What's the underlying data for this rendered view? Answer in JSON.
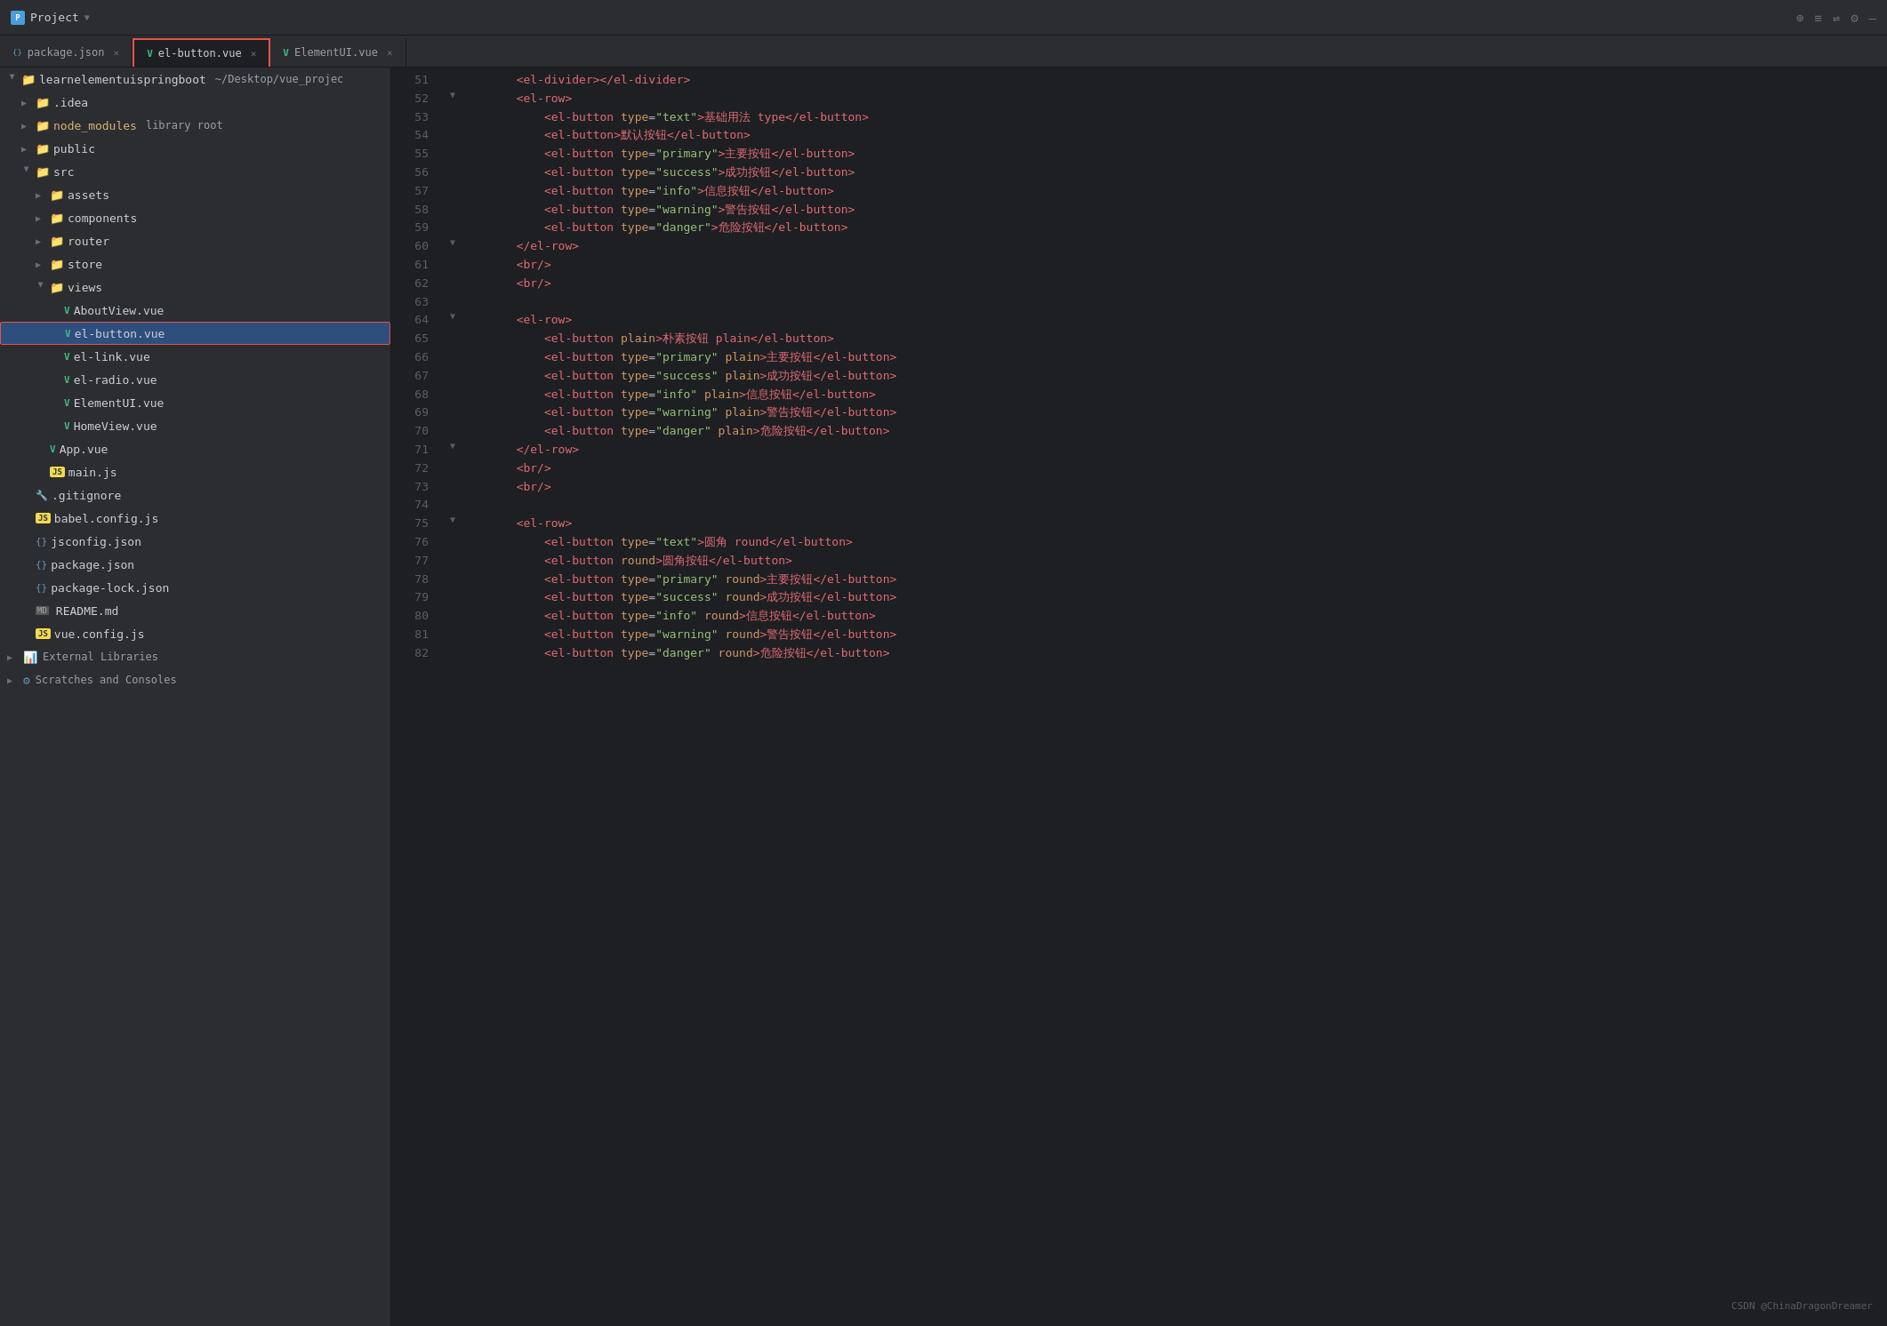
{
  "titleBar": {
    "projectLabel": "Project",
    "projectTitle": "Project",
    "dropdownArrow": "▼",
    "icons": [
      "⊕",
      "≡",
      "⇌",
      "⚙",
      "—"
    ]
  },
  "tabs": [
    {
      "id": "package-json",
      "icon": "json",
      "label": "package.json",
      "active": false,
      "highlighted": false
    },
    {
      "id": "el-button-vue",
      "icon": "vue",
      "label": "el-button.vue",
      "active": true,
      "highlighted": true
    },
    {
      "id": "elementui-vue",
      "icon": "vue",
      "label": "ElementUI.vue",
      "active": false,
      "highlighted": false
    }
  ],
  "sidebar": {
    "rootLabel": "learnelementuispringboot",
    "rootSubtitle": "~/Desktop/vue_projec",
    "items": [
      {
        "indent": 1,
        "type": "folder-blue",
        "arrow": "closed",
        "name": ".idea",
        "subtitle": ""
      },
      {
        "indent": 1,
        "type": "folder-yellow",
        "arrow": "closed",
        "name": "node_modules",
        "subtitle": "library root"
      },
      {
        "indent": 1,
        "type": "folder",
        "arrow": "closed",
        "name": "public",
        "subtitle": ""
      },
      {
        "indent": 1,
        "type": "folder",
        "arrow": "open",
        "name": "src",
        "subtitle": ""
      },
      {
        "indent": 2,
        "type": "folder",
        "arrow": "closed",
        "name": "assets",
        "subtitle": ""
      },
      {
        "indent": 2,
        "type": "folder",
        "arrow": "closed",
        "name": "components",
        "subtitle": ""
      },
      {
        "indent": 2,
        "type": "folder",
        "arrow": "closed",
        "name": "router",
        "subtitle": ""
      },
      {
        "indent": 2,
        "type": "folder",
        "arrow": "closed",
        "name": "store",
        "subtitle": ""
      },
      {
        "indent": 2,
        "type": "folder",
        "arrow": "open",
        "name": "views",
        "subtitle": ""
      },
      {
        "indent": 3,
        "type": "vue",
        "arrow": "none",
        "name": "AboutView.vue",
        "subtitle": ""
      },
      {
        "indent": 3,
        "type": "vue",
        "arrow": "none",
        "name": "el-button.vue",
        "subtitle": "",
        "selected": true
      },
      {
        "indent": 3,
        "type": "vue",
        "arrow": "none",
        "name": "el-link.vue",
        "subtitle": ""
      },
      {
        "indent": 3,
        "type": "vue",
        "arrow": "none",
        "name": "el-radio.vue",
        "subtitle": ""
      },
      {
        "indent": 3,
        "type": "vue",
        "arrow": "none",
        "name": "ElementUI.vue",
        "subtitle": ""
      },
      {
        "indent": 3,
        "type": "vue",
        "arrow": "none",
        "name": "HomeView.vue",
        "subtitle": ""
      },
      {
        "indent": 2,
        "type": "vue",
        "arrow": "none",
        "name": "App.vue",
        "subtitle": ""
      },
      {
        "indent": 2,
        "type": "js",
        "arrow": "none",
        "name": "main.js",
        "subtitle": ""
      },
      {
        "indent": 1,
        "type": "git",
        "arrow": "none",
        "name": ".gitignore",
        "subtitle": ""
      },
      {
        "indent": 1,
        "type": "js",
        "arrow": "none",
        "name": "babel.config.js",
        "subtitle": ""
      },
      {
        "indent": 1,
        "type": "json",
        "arrow": "none",
        "name": "jsconfig.json",
        "subtitle": ""
      },
      {
        "indent": 1,
        "type": "json",
        "arrow": "none",
        "name": "package.json",
        "subtitle": ""
      },
      {
        "indent": 1,
        "type": "json",
        "arrow": "none",
        "name": "package-lock.json",
        "subtitle": ""
      },
      {
        "indent": 1,
        "type": "md",
        "arrow": "none",
        "name": "README.md",
        "subtitle": ""
      },
      {
        "indent": 1,
        "type": "js",
        "arrow": "none",
        "name": "vue.config.js",
        "subtitle": ""
      }
    ],
    "externalLibraries": "External Libraries",
    "scratchesAndConsoles": "Scratches and Consoles"
  },
  "editor": {
    "lines": [
      {
        "num": 51,
        "fold": false,
        "content": [
          {
            "t": "space",
            "v": "        "
          },
          {
            "t": "tag",
            "v": "<el-divider></el-divider>"
          }
        ]
      },
      {
        "num": 52,
        "fold": true,
        "content": [
          {
            "t": "space",
            "v": "        "
          },
          {
            "t": "tag-open",
            "v": "<el-row>"
          }
        ]
      },
      {
        "num": 53,
        "fold": false,
        "content": [
          {
            "t": "space",
            "v": "            "
          },
          {
            "t": "tag",
            "v": "<el-button "
          },
          {
            "t": "attr-name",
            "v": "type"
          },
          {
            "t": "bracket",
            "v": "="
          },
          {
            "t": "attr-value",
            "v": "\"text\""
          },
          {
            "t": "tag",
            "v": ">基础用法 type</el-button>"
          }
        ]
      },
      {
        "num": 54,
        "fold": false,
        "content": [
          {
            "t": "space",
            "v": "            "
          },
          {
            "t": "tag",
            "v": "<el-button>默认按钮</el-button>"
          }
        ]
      },
      {
        "num": 55,
        "fold": false,
        "content": [
          {
            "t": "space",
            "v": "            "
          },
          {
            "t": "tag",
            "v": "<el-button "
          },
          {
            "t": "attr-name",
            "v": "type"
          },
          {
            "t": "bracket",
            "v": "="
          },
          {
            "t": "attr-value",
            "v": "\"primary\""
          },
          {
            "t": "tag",
            "v": ">主要按钮</el-button>"
          }
        ]
      },
      {
        "num": 56,
        "fold": false,
        "content": [
          {
            "t": "space",
            "v": "            "
          },
          {
            "t": "tag",
            "v": "<el-button "
          },
          {
            "t": "attr-name",
            "v": "type"
          },
          {
            "t": "bracket",
            "v": "="
          },
          {
            "t": "attr-value",
            "v": "\"success\""
          },
          {
            "t": "tag",
            "v": ">成功按钮</el-button>"
          }
        ]
      },
      {
        "num": 57,
        "fold": false,
        "content": [
          {
            "t": "space",
            "v": "            "
          },
          {
            "t": "tag",
            "v": "<el-button "
          },
          {
            "t": "attr-name",
            "v": "type"
          },
          {
            "t": "bracket",
            "v": "="
          },
          {
            "t": "attr-value",
            "v": "\"info\""
          },
          {
            "t": "tag",
            "v": ">信息按钮</el-button>"
          }
        ]
      },
      {
        "num": 58,
        "fold": false,
        "content": [
          {
            "t": "space",
            "v": "            "
          },
          {
            "t": "tag",
            "v": "<el-button "
          },
          {
            "t": "attr-name",
            "v": "type"
          },
          {
            "t": "bracket",
            "v": "="
          },
          {
            "t": "attr-value",
            "v": "\"warning\""
          },
          {
            "t": "tag",
            "v": ">警告按钮</el-button>"
          }
        ]
      },
      {
        "num": 59,
        "fold": false,
        "content": [
          {
            "t": "space",
            "v": "            "
          },
          {
            "t": "tag",
            "v": "<el-button "
          },
          {
            "t": "attr-name",
            "v": "type"
          },
          {
            "t": "bracket",
            "v": "="
          },
          {
            "t": "attr-value",
            "v": "\"danger\""
          },
          {
            "t": "tag",
            "v": ">危险按钮</el-button>"
          }
        ]
      },
      {
        "num": 60,
        "fold": true,
        "content": [
          {
            "t": "space",
            "v": "        "
          },
          {
            "t": "tag",
            "v": "</el-row>"
          }
        ]
      },
      {
        "num": 61,
        "fold": false,
        "content": [
          {
            "t": "space",
            "v": "        "
          },
          {
            "t": "tag",
            "v": "<br/>"
          }
        ]
      },
      {
        "num": 62,
        "fold": false,
        "content": [
          {
            "t": "space",
            "v": "        "
          },
          {
            "t": "tag",
            "v": "<br/>"
          }
        ]
      },
      {
        "num": 63,
        "fold": false,
        "content": []
      },
      {
        "num": 64,
        "fold": true,
        "content": [
          {
            "t": "space",
            "v": "        "
          },
          {
            "t": "tag-open",
            "v": "<el-row>"
          }
        ]
      },
      {
        "num": 65,
        "fold": false,
        "content": [
          {
            "t": "space",
            "v": "            "
          },
          {
            "t": "tag",
            "v": "<el-button "
          },
          {
            "t": "attr-name",
            "v": "plain"
          },
          {
            "t": "tag",
            "v": ">朴素按钮 plain</el-button>"
          }
        ]
      },
      {
        "num": 66,
        "fold": false,
        "content": [
          {
            "t": "space",
            "v": "            "
          },
          {
            "t": "tag",
            "v": "<el-button "
          },
          {
            "t": "attr-name",
            "v": "type"
          },
          {
            "t": "bracket",
            "v": "="
          },
          {
            "t": "attr-value",
            "v": "\"primary\""
          },
          {
            "t": "space",
            "v": " "
          },
          {
            "t": "attr-name",
            "v": "plain"
          },
          {
            "t": "tag",
            "v": ">主要按钮</el-button>"
          }
        ]
      },
      {
        "num": 67,
        "fold": false,
        "content": [
          {
            "t": "space",
            "v": "            "
          },
          {
            "t": "tag",
            "v": "<el-button "
          },
          {
            "t": "attr-name",
            "v": "type"
          },
          {
            "t": "bracket",
            "v": "="
          },
          {
            "t": "attr-value",
            "v": "\"success\""
          },
          {
            "t": "space",
            "v": " "
          },
          {
            "t": "attr-name",
            "v": "plain"
          },
          {
            "t": "tag",
            "v": ">成功按钮</el-button>"
          }
        ]
      },
      {
        "num": 68,
        "fold": false,
        "content": [
          {
            "t": "space",
            "v": "            "
          },
          {
            "t": "tag",
            "v": "<el-button "
          },
          {
            "t": "attr-name",
            "v": "type"
          },
          {
            "t": "bracket",
            "v": "="
          },
          {
            "t": "attr-value",
            "v": "\"info\""
          },
          {
            "t": "space",
            "v": " "
          },
          {
            "t": "attr-name",
            "v": "plain"
          },
          {
            "t": "tag",
            "v": ">信息按钮</el-button>"
          }
        ]
      },
      {
        "num": 69,
        "fold": false,
        "content": [
          {
            "t": "space",
            "v": "            "
          },
          {
            "t": "tag",
            "v": "<el-button "
          },
          {
            "t": "attr-name",
            "v": "type"
          },
          {
            "t": "bracket",
            "v": "="
          },
          {
            "t": "attr-value",
            "v": "\"warning\""
          },
          {
            "t": "space",
            "v": " "
          },
          {
            "t": "attr-name",
            "v": "plain"
          },
          {
            "t": "tag",
            "v": ">警告按钮</el-button>"
          }
        ]
      },
      {
        "num": 70,
        "fold": false,
        "content": [
          {
            "t": "space",
            "v": "            "
          },
          {
            "t": "tag",
            "v": "<el-button "
          },
          {
            "t": "attr-name",
            "v": "type"
          },
          {
            "t": "bracket",
            "v": "="
          },
          {
            "t": "attr-value",
            "v": "\"danger\""
          },
          {
            "t": "space",
            "v": " "
          },
          {
            "t": "attr-name",
            "v": "plain"
          },
          {
            "t": "tag",
            "v": ">危险按钮</el-button>"
          }
        ]
      },
      {
        "num": 71,
        "fold": true,
        "content": [
          {
            "t": "space",
            "v": "        "
          },
          {
            "t": "tag",
            "v": "</el-row>"
          }
        ]
      },
      {
        "num": 72,
        "fold": false,
        "content": [
          {
            "t": "space",
            "v": "        "
          },
          {
            "t": "tag",
            "v": "<br/>"
          }
        ]
      },
      {
        "num": 73,
        "fold": false,
        "content": [
          {
            "t": "space",
            "v": "        "
          },
          {
            "t": "tag",
            "v": "<br/>"
          }
        ]
      },
      {
        "num": 74,
        "fold": false,
        "content": []
      },
      {
        "num": 75,
        "fold": true,
        "content": [
          {
            "t": "space",
            "v": "        "
          },
          {
            "t": "tag-open",
            "v": "<el-row>"
          }
        ]
      },
      {
        "num": 76,
        "fold": false,
        "content": [
          {
            "t": "space",
            "v": "            "
          },
          {
            "t": "tag",
            "v": "<el-button "
          },
          {
            "t": "attr-name",
            "v": "type"
          },
          {
            "t": "bracket",
            "v": "="
          },
          {
            "t": "attr-value",
            "v": "\"text\""
          },
          {
            "t": "tag",
            "v": ">圆角 round</el-button>"
          }
        ]
      },
      {
        "num": 77,
        "fold": false,
        "content": [
          {
            "t": "space",
            "v": "            "
          },
          {
            "t": "tag",
            "v": "<el-button "
          },
          {
            "t": "attr-name",
            "v": "round"
          },
          {
            "t": "tag",
            "v": ">圆角按钮</el-button>"
          }
        ]
      },
      {
        "num": 78,
        "fold": false,
        "content": [
          {
            "t": "space",
            "v": "            "
          },
          {
            "t": "tag",
            "v": "<el-button "
          },
          {
            "t": "attr-name",
            "v": "type"
          },
          {
            "t": "bracket",
            "v": "="
          },
          {
            "t": "attr-value",
            "v": "\"primary\""
          },
          {
            "t": "space",
            "v": " "
          },
          {
            "t": "attr-name",
            "v": "round"
          },
          {
            "t": "tag",
            "v": ">主要按钮</el-button>"
          }
        ]
      },
      {
        "num": 79,
        "fold": false,
        "content": [
          {
            "t": "space",
            "v": "            "
          },
          {
            "t": "tag",
            "v": "<el-button "
          },
          {
            "t": "attr-name",
            "v": "type"
          },
          {
            "t": "bracket",
            "v": "="
          },
          {
            "t": "attr-value",
            "v": "\"success\""
          },
          {
            "t": "space",
            "v": " "
          },
          {
            "t": "attr-name",
            "v": "round"
          },
          {
            "t": "tag",
            "v": ">成功按钮</el-button>"
          }
        ]
      },
      {
        "num": 80,
        "fold": false,
        "content": [
          {
            "t": "space",
            "v": "            "
          },
          {
            "t": "tag",
            "v": "<el-button "
          },
          {
            "t": "attr-name",
            "v": "type"
          },
          {
            "t": "bracket",
            "v": "="
          },
          {
            "t": "attr-value",
            "v": "\"info\""
          },
          {
            "t": "space",
            "v": " "
          },
          {
            "t": "attr-name",
            "v": "round"
          },
          {
            "t": "tag",
            "v": ">信息按钮</el-button>"
          }
        ]
      },
      {
        "num": 81,
        "fold": false,
        "content": [
          {
            "t": "space",
            "v": "            "
          },
          {
            "t": "tag",
            "v": "<el-button "
          },
          {
            "t": "attr-name",
            "v": "type"
          },
          {
            "t": "bracket",
            "v": "="
          },
          {
            "t": "attr-value",
            "v": "\"warning\""
          },
          {
            "t": "space",
            "v": " "
          },
          {
            "t": "attr-name",
            "v": "round"
          },
          {
            "t": "tag",
            "v": ">警告按钮</el-button>"
          }
        ]
      },
      {
        "num": 82,
        "fold": false,
        "content": [
          {
            "t": "space",
            "v": "            "
          },
          {
            "t": "tag",
            "v": "<el-button "
          },
          {
            "t": "attr-name",
            "v": "type"
          },
          {
            "t": "bracket",
            "v": "="
          },
          {
            "t": "attr-value",
            "v": "\"danger\""
          },
          {
            "t": "space",
            "v": " "
          },
          {
            "t": "attr-name",
            "v": "round"
          },
          {
            "t": "tag",
            "v": ">危险按钮</el-button>"
          }
        ]
      }
    ]
  },
  "watermark": "CSDN @ChinaDragonDreamer"
}
